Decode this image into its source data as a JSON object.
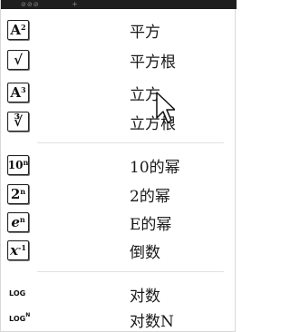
{
  "menu": {
    "items": [
      {
        "icon": "square-power-icon",
        "icon_base": "A",
        "icon_sup": "2",
        "label": "平方"
      },
      {
        "icon": "square-root-icon",
        "icon_base": "√",
        "icon_sup": "",
        "label": "平方根"
      },
      {
        "icon": "cube-power-icon",
        "icon_base": "A",
        "icon_sup": "3",
        "label": "立方"
      },
      {
        "icon": "cube-root-icon",
        "icon_base": "∛",
        "icon_sup": "",
        "label": "立方根"
      },
      {
        "icon": "ten-power-icon",
        "icon_base": "10",
        "icon_sup": "n",
        "label": "10的幂"
      },
      {
        "icon": "two-power-icon",
        "icon_base": "2",
        "icon_sup": "n",
        "label": "2的幂"
      },
      {
        "icon": "e-power-icon",
        "icon_base": "e",
        "icon_sup": "n",
        "label": "E的幂"
      },
      {
        "icon": "reciprocal-icon",
        "icon_base": "x",
        "icon_sup": "-1",
        "label": "倒数"
      },
      {
        "icon": "log-icon",
        "icon_base": "LOG",
        "icon_sup": "",
        "label": "对数"
      },
      {
        "icon": "log-n-icon",
        "icon_base": "LOG",
        "icon_sup": "N",
        "label": "对数N"
      }
    ]
  }
}
